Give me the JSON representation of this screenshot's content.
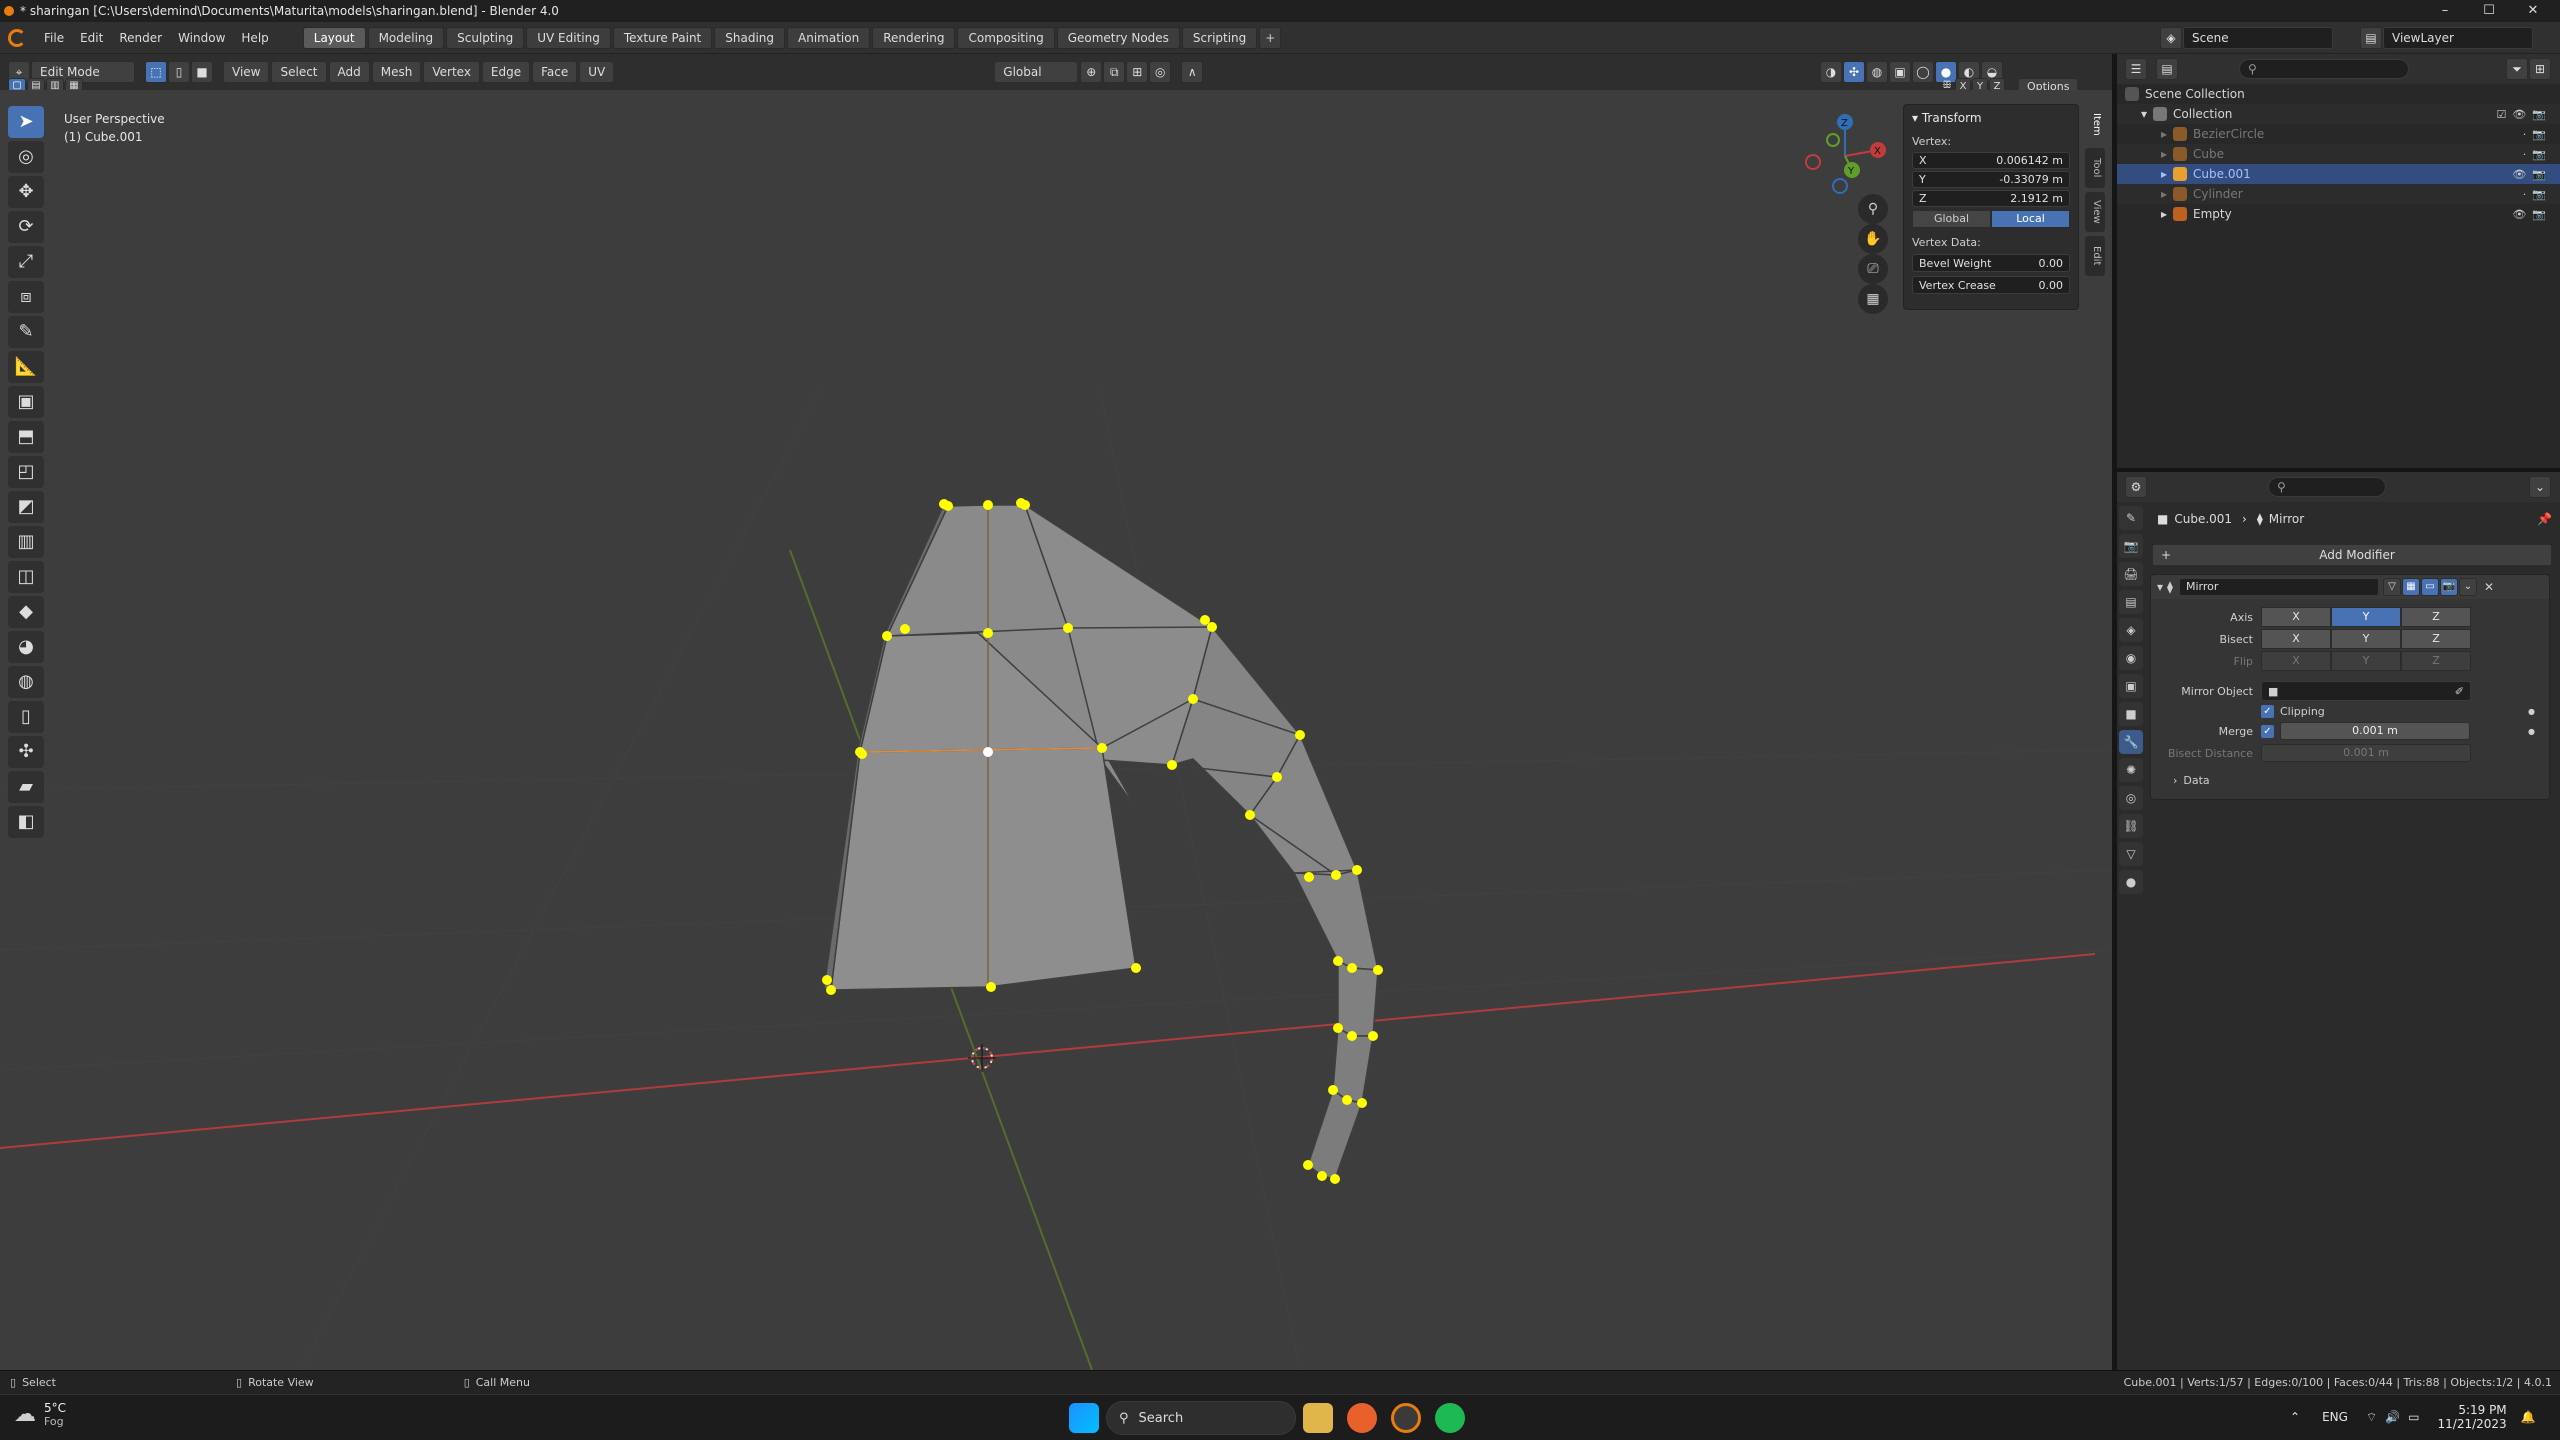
{
  "window": {
    "title": "* sharingan [C:\\Users\\demind\\Documents\\Maturita\\models\\sharingan.blend] - Blender 4.0",
    "minimize": "–",
    "maximize": "☐",
    "close": "✕"
  },
  "menu": [
    "File",
    "Edit",
    "Render",
    "Window",
    "Help"
  ],
  "workspaces": [
    "Layout",
    "Modeling",
    "Sculpting",
    "UV Editing",
    "Texture Paint",
    "Shading",
    "Animation",
    "Rendering",
    "Compositing",
    "Geometry Nodes",
    "Scripting"
  ],
  "workspace_add": "+",
  "scene": {
    "name": "Scene",
    "view_layer": "ViewLayer"
  },
  "header": {
    "mode": "Edit Mode",
    "menus": [
      "View",
      "Select",
      "Add",
      "Mesh",
      "Vertex",
      "Edge",
      "Face",
      "UV"
    ],
    "orientation": "Global",
    "axis_x": "X",
    "axis_y": "Y",
    "axis_z": "Z",
    "options": "Options"
  },
  "viewport": {
    "perspective": "User Perspective",
    "object": "(1) Cube.001"
  },
  "gizmo": {
    "z": "Z",
    "y": "Y",
    "x": "X"
  },
  "npanel": {
    "title": "Transform",
    "vertex_label": "Vertex:",
    "x_label": "X",
    "x_value": "0.006142 m",
    "y_label": "Y",
    "y_value": "-0.33079 m",
    "z_label": "Z",
    "z_value": "2.1912 m",
    "global": "Global",
    "local": "Local",
    "vertex_data": "Vertex Data:",
    "bevel_label": "Bevel Weight",
    "bevel_value": "0.00",
    "crease_label": "Vertex Crease",
    "crease_value": "0.00",
    "tabs": [
      "Item",
      "Tool",
      "View",
      "Edit"
    ]
  },
  "outliner": {
    "root": "Scene Collection",
    "collection": "Collection",
    "items": [
      "BezierCircle",
      "Cube",
      "Cube.001",
      "Cylinder",
      "Empty"
    ]
  },
  "properties": {
    "object": "Cube.001",
    "modifier_crumb": "Mirror",
    "add_modifier": "Add Modifier",
    "modifier_name": "Mirror",
    "axis_label": "Axis",
    "bisect_label": "Bisect",
    "flip_label": "Flip",
    "mirror_object_label": "Mirror Object",
    "clipping": "Clipping",
    "merge_label": "Merge",
    "merge_value": "0.001 m",
    "bisect_distance_label": "Bisect Distance",
    "bisect_distance_value": "0.001 m",
    "data": "Data",
    "x": "X",
    "y": "Y",
    "z": "Z"
  },
  "status": {
    "select": "Select",
    "rotate": "Rotate View",
    "call_menu": "Call Menu",
    "stats": "Cube.001 | Verts:1/57 | Edges:0/100 | Faces:0/44 | Tris:88 | Objects:1/2 | 4.0.1"
  },
  "taskbar": {
    "weather_temp": "5°C",
    "weather_desc": "Fog",
    "search": "Search",
    "lang": "ENG",
    "time": "5:19 PM",
    "date": "11/21/2023"
  },
  "colors": {
    "accent": "#4772b3",
    "selected_vertex": "#ffff00",
    "mesh": "#8e8e8e",
    "x_axis": "#c33c3c",
    "y_axis": "#5a7a2a"
  }
}
